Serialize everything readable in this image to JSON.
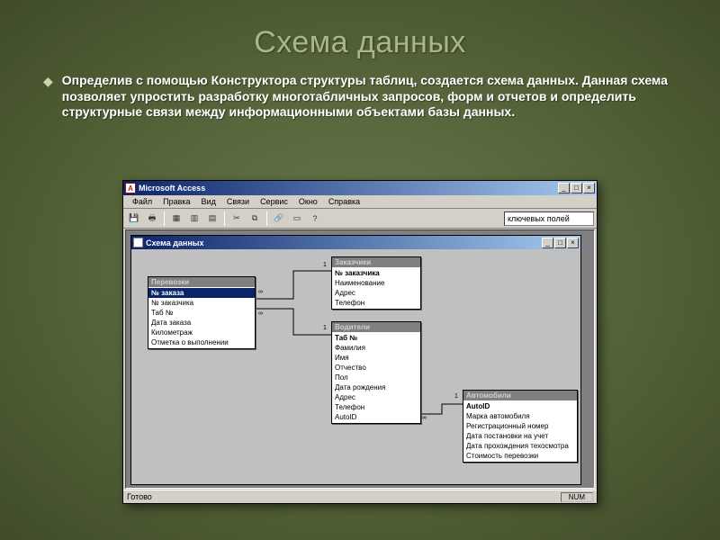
{
  "slide": {
    "title": "Схема данных",
    "description": "Определив с помощью Конструктора структуры таблиц, создается схема данных. Данная схема позволяет упростить разработку многотабличных запросов, форм и отчетов и определить структурные связи между информационными объектами базы данных."
  },
  "app": {
    "title": "Microsoft Access",
    "menu": [
      "Файл",
      "Правка",
      "Вид",
      "Связи",
      "Сервис",
      "Окно",
      "Справка"
    ],
    "combo_value": "ключевых полей",
    "child_title": "Схема данных",
    "statusbar_left": "Готово",
    "statusbar_right": "NUM"
  },
  "tables": {
    "perevozki": {
      "title": "Перевозки",
      "fields": [
        "№ заказа",
        "№ заказчика",
        "Таб №",
        "Дата заказа",
        "Километраж",
        "Отметка о выполнении"
      ]
    },
    "zakazchiki": {
      "title": "Заказчики",
      "fields": [
        "№ заказчика",
        "Наименование",
        "Адрес",
        "Телефон"
      ]
    },
    "voditeli": {
      "title": "Водители",
      "fields": [
        "Таб №",
        "Фамилия",
        "Имя",
        "Отчество",
        "Пол",
        "Дата рождения",
        "Адрес",
        "Телефон",
        "AutoID"
      ]
    },
    "avtomobili": {
      "title": "Автомобили",
      "fields": [
        "AutoID",
        "Марка автомобиля",
        "Регистрационный номер",
        "Дата постановки на учет",
        "Дата прохождения техосмотра",
        "Стоимость перевозки"
      ]
    }
  }
}
